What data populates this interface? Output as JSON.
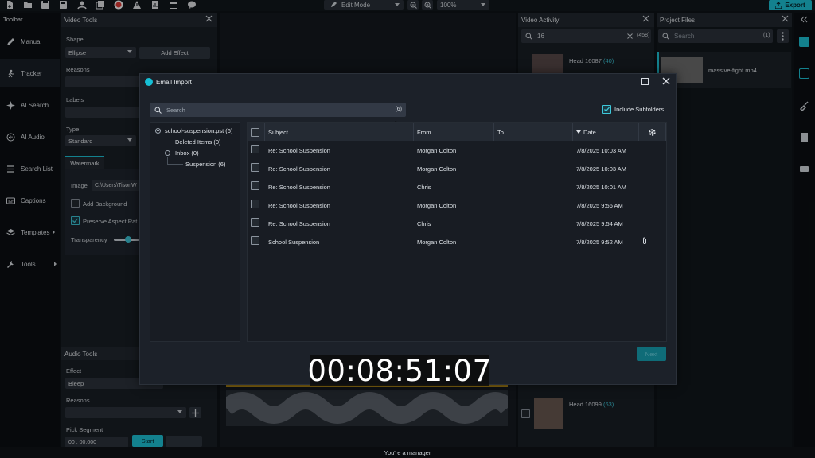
{
  "toolbar": {
    "mode": "Edit Mode",
    "zoom": "100%",
    "export_label": "Export",
    "icons": [
      "new-file-icon",
      "open-folder-icon",
      "save-icon",
      "person-icon",
      "copy-icon",
      "record-icon",
      "warning-icon",
      "report-icon",
      "calendar-icon",
      "chat-icon"
    ]
  },
  "sidebar": {
    "title": "Toolbar",
    "items": [
      {
        "label": "Manual"
      },
      {
        "label": "Tracker"
      },
      {
        "label": "AI Search"
      },
      {
        "label": "AI Audio"
      },
      {
        "label": "Search List"
      },
      {
        "label": "Captions"
      },
      {
        "label": "Templates"
      },
      {
        "label": "Tools"
      }
    ]
  },
  "video_tools": {
    "title": "Video Tools",
    "shape_label": "Shape",
    "shape_value": "Ellipse",
    "add_effect": "Add Effect",
    "reasons_label": "Reasons",
    "labels_label": "Labels",
    "type_label": "Type",
    "type_value": "Standard",
    "watermark_tab": "Watermark",
    "image_label": "Image",
    "image_value": "C:\\Users\\TisonW",
    "add_background": "Add Background",
    "preserve_aspect": "Preserve Aspect Rat",
    "transparency_label": "Transparency"
  },
  "audio_tools": {
    "title": "Audio Tools",
    "effect_label": "Effect",
    "effect_value": "Bleep",
    "reasons_label": "Reasons",
    "pick_segment_label": "Pick Segment",
    "time_value": "00 : 00.000",
    "start_label": "Start"
  },
  "video_activity": {
    "title": "Video Activity",
    "search_value": "16",
    "search_count": "(458)",
    "items": [
      {
        "label": "Head 16087",
        "count": "(40)"
      },
      {
        "label": "Head 16099",
        "count": "(63)"
      }
    ]
  },
  "project_files": {
    "title": "Project Files",
    "search_placeholder": "Search",
    "search_count": "(1)",
    "file_name": "massive-fight.mp4"
  },
  "modal": {
    "title": "Email Import",
    "search_placeholder": "Search",
    "search_count": "(6)",
    "include_subfolders": "Include Subfolders",
    "tree": [
      {
        "label": "school-suspension.pst (6)"
      },
      {
        "label": "Deleted Items (0)"
      },
      {
        "label": "Inbox (0)"
      },
      {
        "label": "Suspension (6)"
      }
    ],
    "columns": {
      "subject": "Subject",
      "from": "From",
      "to": "To",
      "date": "Date"
    },
    "rows": [
      {
        "subject": "Re: School Suspension",
        "from": "Morgan Colton",
        "to": "",
        "date": "7/8/2025 10:03 AM"
      },
      {
        "subject": "Re: School Suspension",
        "from": "Morgan Colton",
        "to": "",
        "date": "7/8/2025 10:03 AM"
      },
      {
        "subject": "Re: School Suspension",
        "from": "Chris",
        "to": "",
        "date": "7/8/2025 10:01 AM"
      },
      {
        "subject": "Re: School Suspension",
        "from": "Morgan Colton",
        "to": "",
        "date": "7/8/2025 9:56 AM"
      },
      {
        "subject": "Re: School Suspension",
        "from": "Chris",
        "to": "",
        "date": "7/8/2025 9:54 AM"
      },
      {
        "subject": "School Suspension",
        "from": "Morgan Colton",
        "to": "",
        "date": "7/8/2025 9:52 AM"
      }
    ],
    "next_label": "Next"
  },
  "timecode": "00:08:51:07",
  "status": "You're a manager",
  "colors": {
    "accent": "#1ec6da",
    "record": "#e53935"
  }
}
